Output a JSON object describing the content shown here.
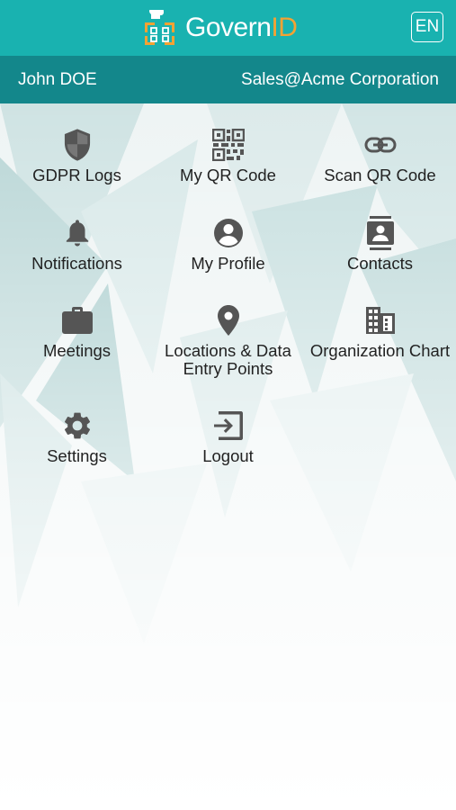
{
  "header": {
    "brand_prefix": "Govern",
    "brand_suffix": "ID",
    "language": "EN",
    "brand_accent": "#f4a233",
    "bar_color": "#19b2b0"
  },
  "user": {
    "name": "John DOE",
    "organization": "Sales@Acme Corporation",
    "bar_color": "#13878b"
  },
  "menu": {
    "items": [
      {
        "label": "GDPR Logs",
        "icon": "shield-icon"
      },
      {
        "label": "My QR Code",
        "icon": "qr-code-icon"
      },
      {
        "label": "Scan QR Code",
        "icon": "link-icon"
      },
      {
        "label": "Notifications",
        "icon": "bell-icon"
      },
      {
        "label": "My Profile",
        "icon": "account-circle-icon"
      },
      {
        "label": "Contacts",
        "icon": "contacts-icon"
      },
      {
        "label": "Meetings",
        "icon": "briefcase-icon"
      },
      {
        "label": "Locations & Data Entry Points",
        "icon": "location-pin-icon"
      },
      {
        "label": "Organization Chart",
        "icon": "building-icon"
      },
      {
        "label": "Settings",
        "icon": "gear-icon"
      },
      {
        "label": "Logout",
        "icon": "logout-icon"
      }
    ]
  }
}
